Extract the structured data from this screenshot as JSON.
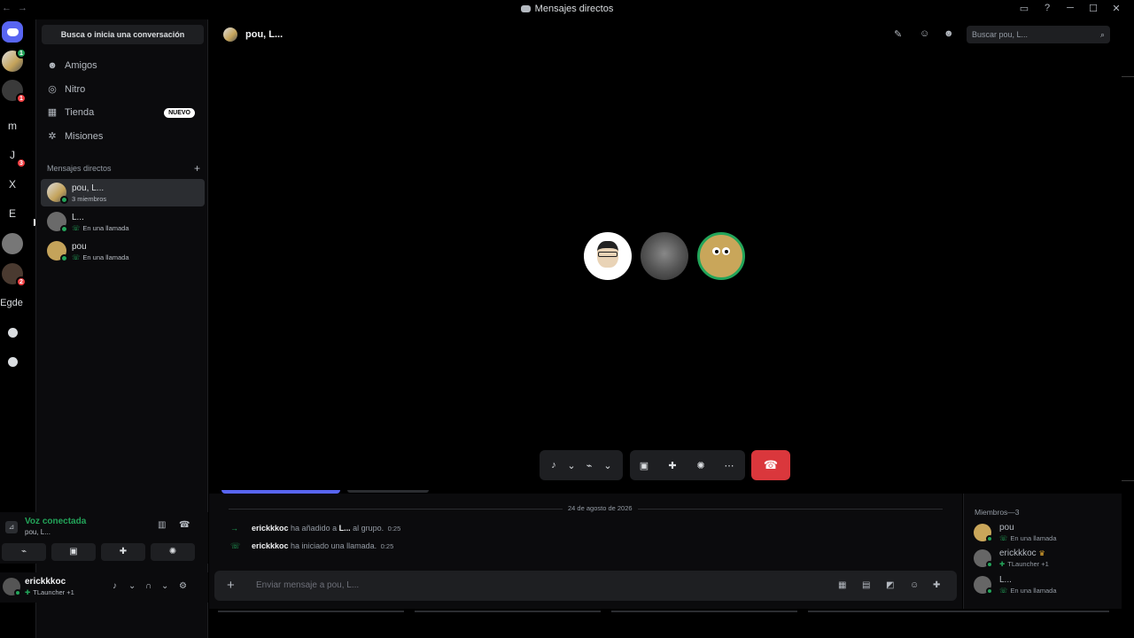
{
  "window": {
    "nav_arrows": "← →",
    "title": "Mensajes directos",
    "buttons": [
      "▭",
      "?",
      "─",
      "☐",
      "✕"
    ]
  },
  "servers": [
    {
      "label": "",
      "badge": ""
    },
    {
      "label": "",
      "badge": "1"
    },
    {
      "label": "",
      "badge": "1"
    },
    {
      "label": "m",
      "badge": ""
    },
    {
      "label": "J",
      "badge": "3"
    },
    {
      "label": "X",
      "badge": ""
    },
    {
      "label": "E",
      "badge": ""
    },
    {
      "label": "",
      "badge": ""
    },
    {
      "label": "",
      "badge": "2"
    },
    {
      "label": "Egde",
      "badge": ""
    }
  ],
  "sidebar": {
    "search_label": "Busca o inicia una conversación",
    "nav": [
      {
        "label": "Amigos",
        "icon": "friends-icon"
      },
      {
        "label": "Nitro",
        "icon": "nitro-icon"
      },
      {
        "label": "Tienda",
        "icon": "shop-icon",
        "badge": "NUEVO"
      },
      {
        "label": "Misiones",
        "icon": "quests-icon"
      }
    ],
    "dm_header": "Mensajes directos",
    "dms": [
      {
        "name": "pou, L...",
        "sub": "3 miembros"
      },
      {
        "name": "L...",
        "sub": "En una llamada"
      },
      {
        "name": "pou",
        "sub": "En una llamada"
      }
    ]
  },
  "voice": {
    "title": "Voz conectada",
    "sub": "pou, L..."
  },
  "user": {
    "name": "erickkkoc",
    "status": "TLauncher",
    "extra": "+1"
  },
  "header": {
    "title": "pou, L...",
    "search_placeholder": "Buscar pou, L..."
  },
  "chat": {
    "date": "24 de agosto de 2026",
    "messages": [
      {
        "user": "erickkkoc",
        "text_before": " ha añadido a ",
        "target": "L...",
        "text_after": " al grupo.",
        "time": "0:25"
      },
      {
        "user": "erickkkoc",
        "text": " ha iniciado una llamada.",
        "time": "0:25"
      }
    ],
    "input_placeholder": "Enviar mensaje a pou, L..."
  },
  "members": {
    "header": "Miembros—3",
    "list": [
      {
        "name": "pou",
        "status": "En una llamada"
      },
      {
        "name": "erickkkoc",
        "status": "TLauncher",
        "extra": "+1"
      },
      {
        "name": "L...",
        "status": "En una llamada"
      }
    ]
  },
  "colors": {
    "accent": "#5865f2",
    "online": "#23a55a",
    "danger": "#da373c",
    "badge": "#f23f43"
  }
}
